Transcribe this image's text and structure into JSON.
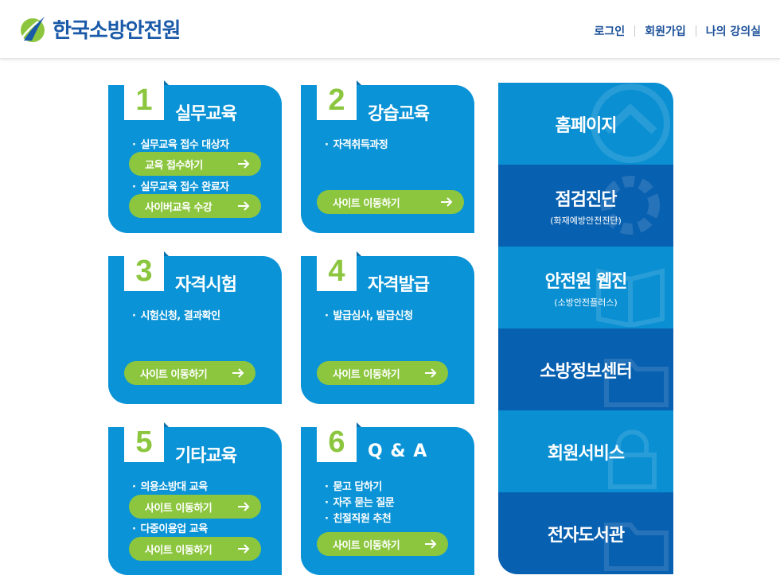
{
  "header": {
    "logo_text": "한국소방안전원",
    "nav": [
      "로그인",
      "회원가입",
      "나의 강의실"
    ]
  },
  "cards": [
    {
      "num": "1",
      "title": "실무교육",
      "b1": "실무교육 접수 대상자",
      "p1": "교육 접수하기",
      "b2": "실무교육 접수 완료자",
      "p2": "사이버교육 수강"
    },
    {
      "num": "2",
      "title": "강습교육",
      "b1": "자격취득과정",
      "p1": "사이트 이동하기"
    },
    {
      "num": "3",
      "title": "자격시험",
      "b1": "시험신청, 결과확인",
      "p1": "사이트 이동하기"
    },
    {
      "num": "4",
      "title": "자격발급",
      "b1": "발급심사, 발급신청",
      "p1": "사이트 이동하기"
    },
    {
      "num": "5",
      "title": "기타교육",
      "b1": "의용소방대 교육",
      "p1": "사이트 이동하기",
      "b2": "다중이용업 교육",
      "p2": "사이트 이동하기"
    },
    {
      "num": "6",
      "title": "Q & A",
      "b1": "묻고 답하기",
      "b2": "자주 묻는 질문",
      "b3": "친절직원 추천",
      "p1": "사이트 이동하기"
    }
  ],
  "side": [
    {
      "title": "홈페이지",
      "sub": ""
    },
    {
      "title": "점검진단",
      "sub": "(화재예방안전진단)"
    },
    {
      "title": "안전원 웹진",
      "sub": "(소방안전플러스)"
    },
    {
      "title": "소방정보센터",
      "sub": ""
    },
    {
      "title": "회원서비스",
      "sub": ""
    },
    {
      "title": "전자도서관",
      "sub": ""
    }
  ],
  "colors": {
    "brand_blue": "#0a93d6",
    "dark_blue": "#0860b0",
    "green": "#8cc63f",
    "logo_blue": "#1a5aa8"
  }
}
